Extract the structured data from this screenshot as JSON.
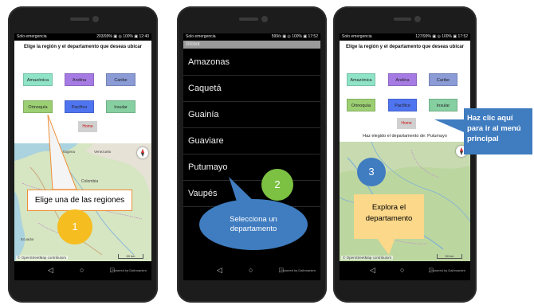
{
  "status_bar": {
    "left_text": "Solo emergencia",
    "phone1_right": "203/99% ▣ ◎ 100% ▣ 12:40",
    "phone2_right": "599/s ▣ ◎ 100% ▣ 17:52",
    "phone3_right": "127/99% ▣ ◎ 100% ▣ 17:52"
  },
  "app": {
    "prompt": "Elige la región y el departamento que deseas ubicar",
    "home_label": "Home",
    "picker_header": "Gfcbot",
    "selected_text": "Haz elegido el departamento de: Putumayo",
    "map_attribution": "© OpenStreetMap contributors",
    "scale_label": "50 km",
    "powered_label": "Powered by Dalhmanten"
  },
  "regions": [
    {
      "label": "Amazónica",
      "color": "#8fe3c7"
    },
    {
      "label": "Andina",
      "color": "#a57be3"
    },
    {
      "label": "Caribe",
      "color": "#8a9bd6"
    },
    {
      "label": "Orinoquía",
      "color": "#9ccf73"
    },
    {
      "label": "Pacífico",
      "color": "#4f74f0"
    },
    {
      "label": "Insular",
      "color": "#86cfa0"
    }
  ],
  "departments": [
    "Amazonas",
    "Caquetá",
    "Guainía",
    "Guaviare",
    "Putumayo",
    "Vaupés"
  ],
  "map_labels": [
    "Cartagena",
    "Venezuela",
    "Colombia",
    "Ecuador"
  ],
  "annotations": {
    "step1_text": "Elige una de las regiones",
    "step1_number": "1",
    "step2_text": "Selecciona un departamento",
    "step2_number": "2",
    "step3_number": "3",
    "step3_text": "Explora el departamento",
    "home_hint": "Haz clic aquí para ir al menú principal"
  },
  "nav_icons": [
    "back-icon",
    "home-circle-icon",
    "recents-icon"
  ]
}
